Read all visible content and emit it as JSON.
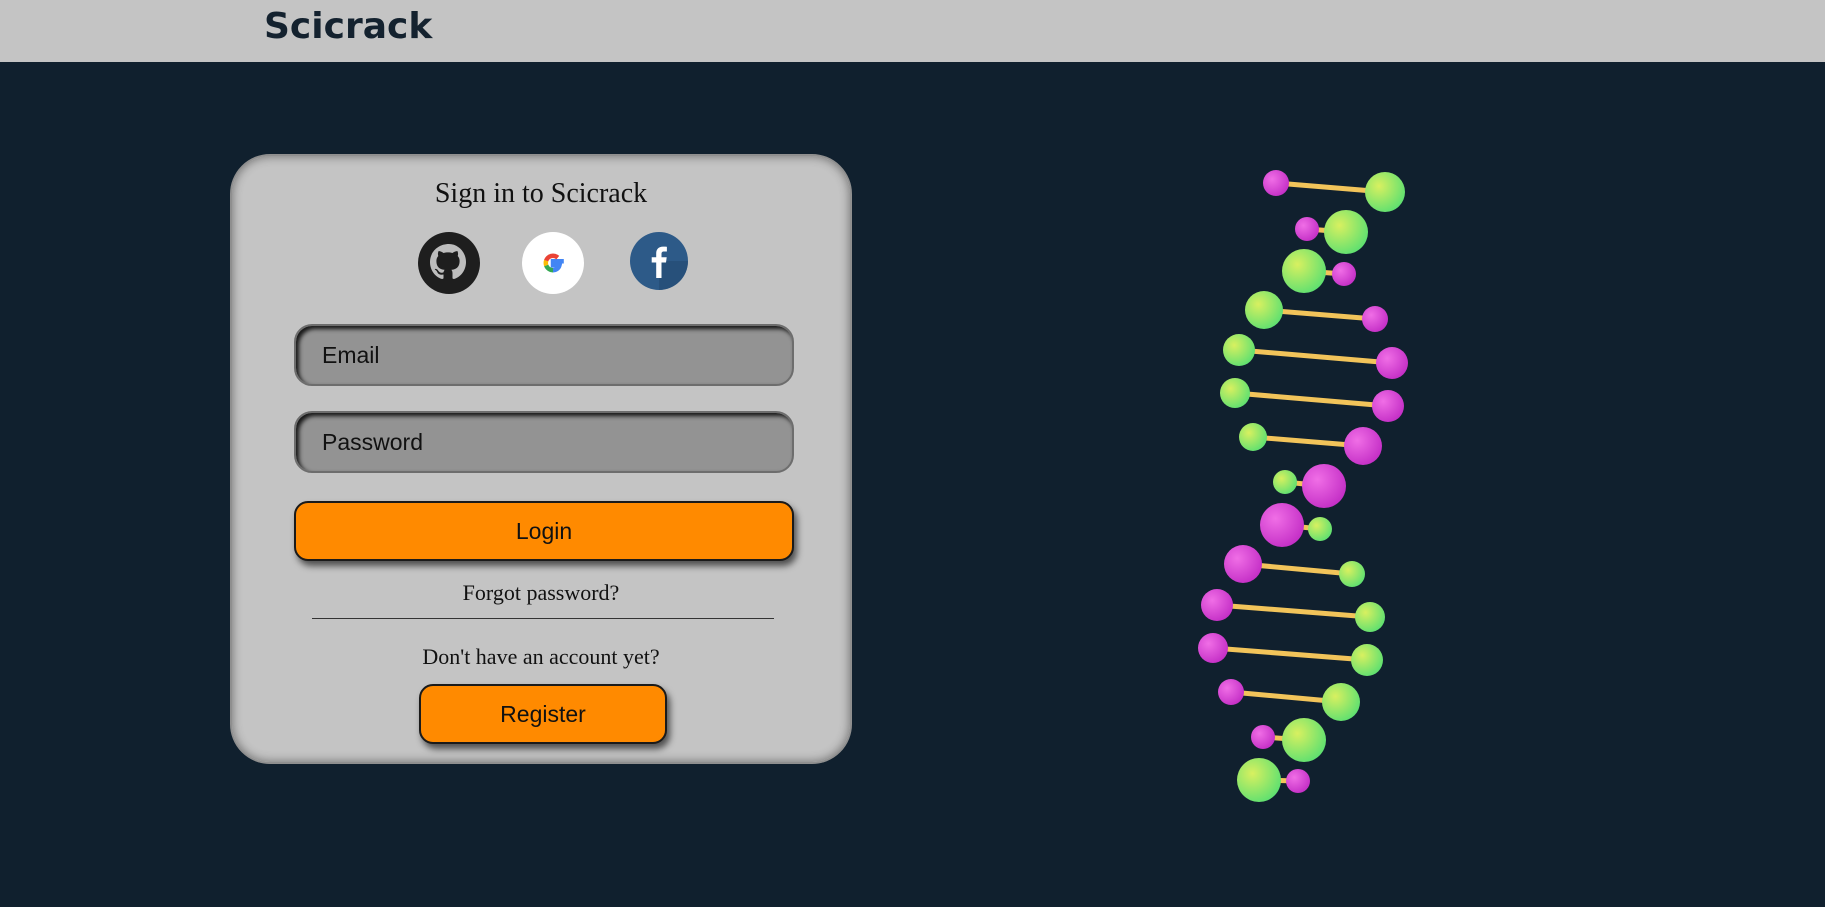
{
  "header": {
    "brand": "Scicrack"
  },
  "login_card": {
    "title": "Sign in to Scicrack",
    "social": [
      {
        "name": "github-icon"
      },
      {
        "name": "google-icon"
      },
      {
        "name": "facebook-icon"
      }
    ],
    "email_placeholder": "Email",
    "password_placeholder": "Password",
    "login_label": "Login",
    "forgot_label": "Forgot password?",
    "no_account_label": "Don't have an account yet?",
    "register_label": "Register"
  },
  "colors": {
    "background": "#10202e",
    "header": "#c4c4c4",
    "card": "#c4c4c4",
    "button": "#ff8a00",
    "input": "#939393",
    "dna_pink": "#e040d8",
    "dna_green": "#86e860",
    "dna_rung": "#f2c45a"
  }
}
